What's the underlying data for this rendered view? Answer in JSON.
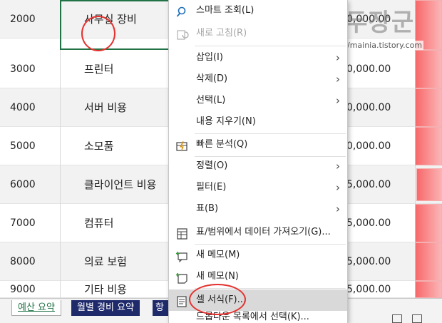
{
  "sheet": {
    "rows": [
      {
        "code": "2000",
        "name": "사무실 장비",
        "amount": "0,000.00"
      },
      {
        "code": "3000",
        "name": "프린터",
        "amount": "0,000.00"
      },
      {
        "code": "4000",
        "name": "서버 비용",
        "amount": "0,000.00"
      },
      {
        "code": "5000",
        "name": "소모품",
        "amount": "0,000.00"
      },
      {
        "code": "6000",
        "name": "클라이언트 비용",
        "amount": "5,000.00"
      },
      {
        "code": "7000",
        "name": "컴퓨터",
        "amount": "5,000.00"
      },
      {
        "code": "8000",
        "name": "의료 보험",
        "amount": "5,000.00"
      },
      {
        "code": "9000",
        "name": "기타 비용",
        "amount": "5,000.00"
      }
    ]
  },
  "watermark": {
    "title": "녹두장군",
    "url": "http://mainia.tistory.com"
  },
  "tabs": {
    "active": "예산 요약",
    "second": "월별 경비 요약",
    "third": "항"
  },
  "menu": {
    "items": [
      {
        "label": "스마트 조회(L)",
        "icon": "smart-lookup-icon"
      },
      {
        "label": "새로 고침(R)",
        "icon": "refresh-icon",
        "disabled": true
      },
      {
        "label": "삽입(I)",
        "submenu": true
      },
      {
        "label": "삭제(D)",
        "submenu": true
      },
      {
        "label": "선택(L)",
        "submenu": true
      },
      {
        "label": "내용 지우기(N)"
      },
      {
        "label": "빠른 분석(Q)",
        "icon": "quick-analysis-icon"
      },
      {
        "label": "정렬(O)",
        "submenu": true
      },
      {
        "label": "필터(E)",
        "submenu": true
      },
      {
        "label": "표(B)",
        "submenu": true
      },
      {
        "label": "표/범위에서 데이터 가져오기(G)...",
        "icon": "table-import-icon"
      },
      {
        "label": "새 메모(M)",
        "icon": "new-comment-icon"
      },
      {
        "label": "새 메모(N)",
        "icon": "new-note-icon"
      },
      {
        "label": "셀 서식(F)...",
        "icon": "format-cells-icon"
      },
      {
        "label": "드롭다운 목록에서 선택(K)..."
      }
    ]
  },
  "colors": {
    "accent": "#217346",
    "annotation": "#e5322e",
    "databar": "#f8696b"
  }
}
